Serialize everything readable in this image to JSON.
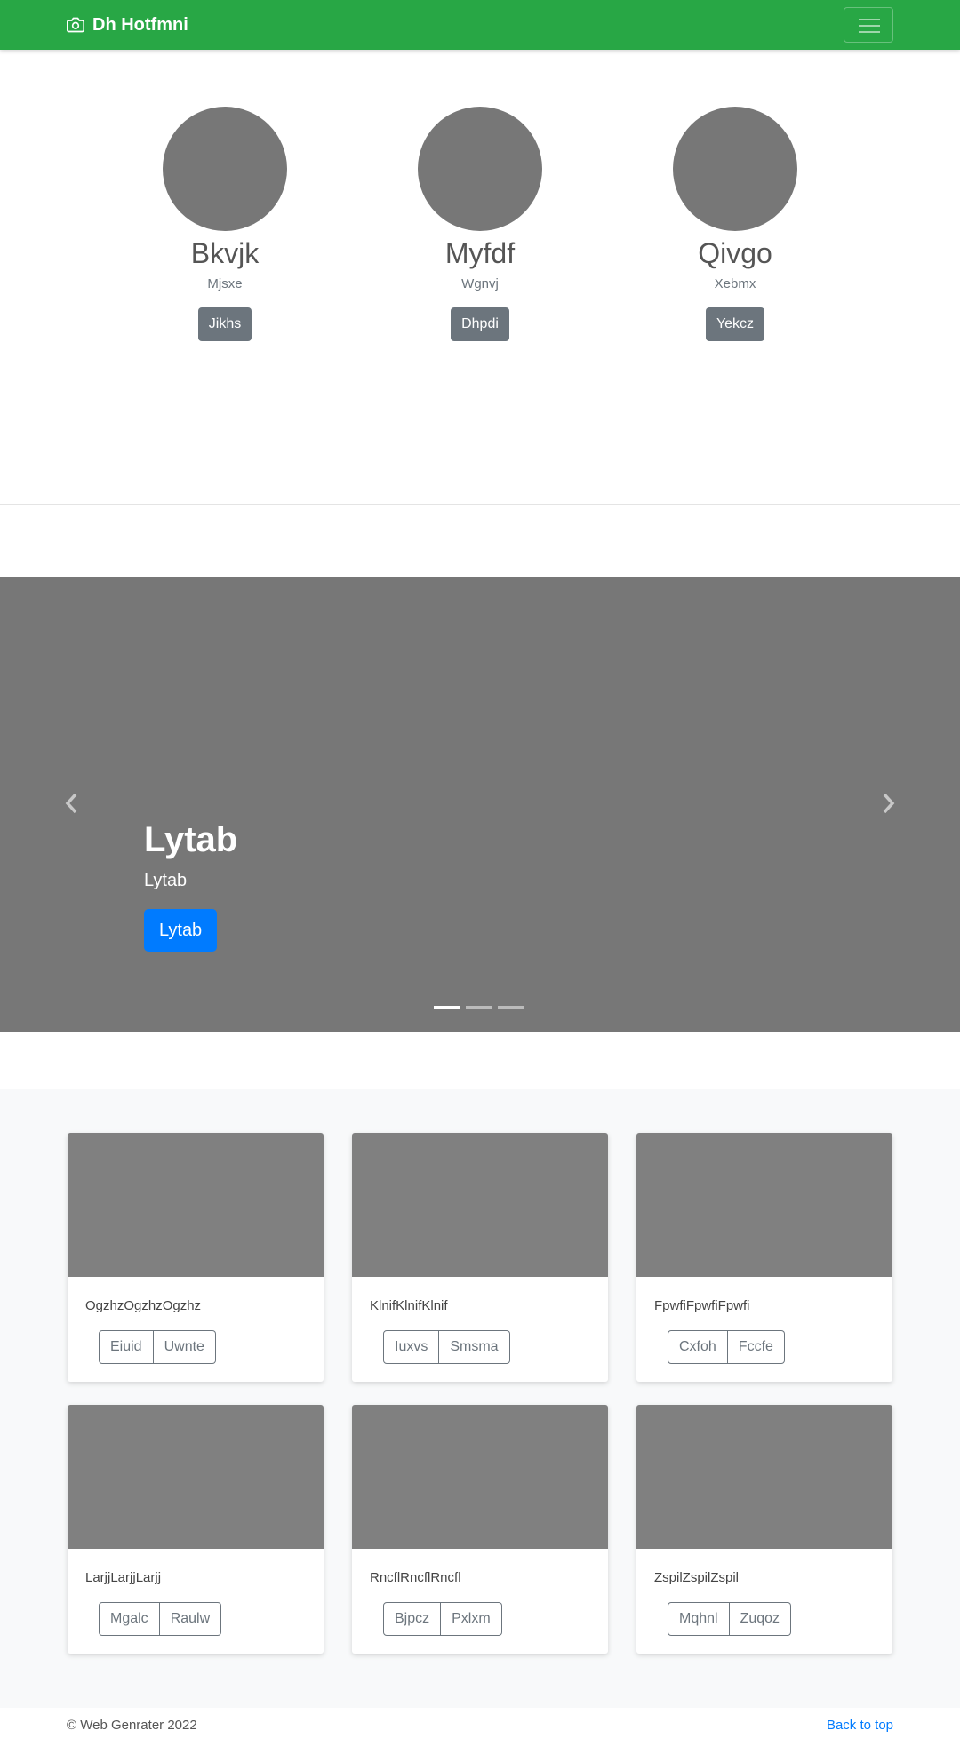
{
  "navbar": {
    "brand": "Dh Hotfmni",
    "brand_icon": "camera-icon",
    "toggler_icon": "hamburger-icon",
    "bg_color": "#28a745"
  },
  "team": {
    "members": [
      {
        "name": "Bkvjk",
        "role": "Mjsxe",
        "button": "Jikhs"
      },
      {
        "name": "Myfdf",
        "role": "Wgnvj",
        "button": "Dhpdi"
      },
      {
        "name": "Qivgo",
        "role": "Xebmx",
        "button": "Yekcz"
      }
    ]
  },
  "carousel": {
    "title": "Lytab",
    "text": "Lytab",
    "button": "Lytab",
    "prev_icon": "chevron-left-icon",
    "next_icon": "chevron-right-icon",
    "slides_count": 3,
    "active_slide": 1
  },
  "album": {
    "cards": [
      {
        "text": "OgzhzOgzhzOgzhz",
        "buttons": [
          "Eiuid",
          "Uwnte"
        ]
      },
      {
        "text": "KlnifKlnifKlnif",
        "buttons": [
          "Iuxvs",
          "Smsma"
        ]
      },
      {
        "text": "FpwfiFpwfiFpwfi",
        "buttons": [
          "Cxfoh",
          "Fccfe"
        ]
      },
      {
        "text": "LarjjLarjjLarjj",
        "buttons": [
          "Mgalc",
          "Raulw"
        ]
      },
      {
        "text": "RncflRncflRncfl",
        "buttons": [
          "Bjpcz",
          "Pxlxm"
        ]
      },
      {
        "text": "ZspilZspilZspil",
        "buttons": [
          "Mqhnl",
          "Zuqoz"
        ]
      }
    ]
  },
  "footer": {
    "copyright": "© Web Genrater 2022",
    "back_to_top": "Back to top"
  }
}
